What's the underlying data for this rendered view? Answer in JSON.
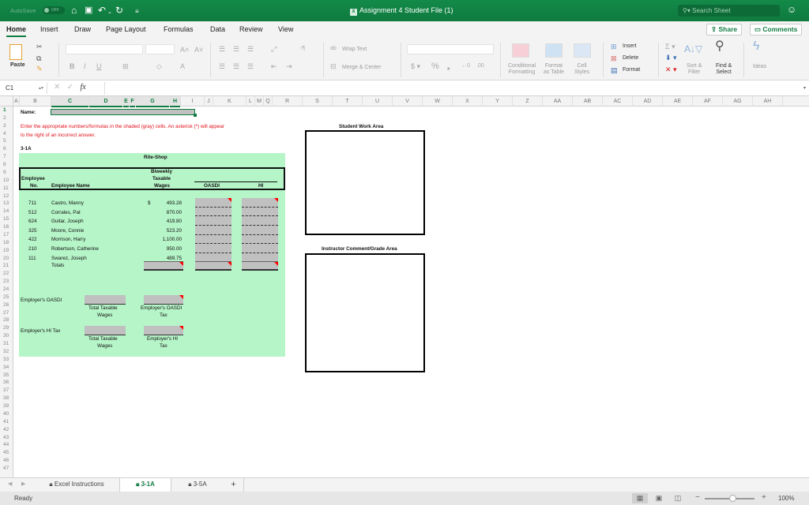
{
  "titlebar": {
    "autosave_label": "AutoSave",
    "autosave_state": "OFF",
    "title": "Assignment 4 Student File (1)",
    "search_placeholder": "Search Sheet"
  },
  "ribbon_tabs": [
    "Home",
    "Insert",
    "Draw",
    "Page Layout",
    "Formulas",
    "Data",
    "Review",
    "View"
  ],
  "active_ribbon_tab": "Home",
  "share_label": "Share",
  "comments_label": "Comments",
  "ribbon": {
    "paste": "Paste",
    "wrap_text": "Wrap Text",
    "merge_center": "Merge & Center",
    "conditional_formatting": [
      "Conditional",
      "Formatting"
    ],
    "format_as_table": [
      "Format",
      "as Table"
    ],
    "cell_styles": [
      "Cell",
      "Styles"
    ],
    "insert": "Insert",
    "delete": "Delete",
    "format": "Format",
    "sort_filter": [
      "Sort &",
      "Filter"
    ],
    "find_select": [
      "Find &",
      "Select"
    ],
    "ideas": "Ideas"
  },
  "formula_bar": {
    "name_box": "C1",
    "fx": "fx",
    "value": ""
  },
  "columns": [
    "A",
    "B",
    "C",
    "D",
    "E",
    "F",
    "G",
    "H",
    "I",
    "J",
    "K",
    "L",
    "M",
    "Q",
    "R",
    "S",
    "T",
    "U",
    "V",
    "W",
    "X",
    "Y",
    "Z",
    "AA",
    "AB",
    "AC",
    "AD",
    "AE",
    "AF",
    "AG",
    "AH"
  ],
  "selected_columns": [
    "C",
    "D",
    "E",
    "F",
    "G",
    "H"
  ],
  "selected_row": 1,
  "row_count": 47,
  "sheet": {
    "name_label": "Name:",
    "instructions_line1": "Enter the appropriate numbers/formulas in the shaded (gray) cells. An asterisk (*) will appear",
    "instructions_line2": "to the right of an incorrect answer.",
    "problem_label": "3-1A",
    "company": "Rite-Shop",
    "headers": {
      "emp_no_1": "Employee",
      "emp_no_2": "No.",
      "emp_name": "Employee Name",
      "wages_1": "Biweekly",
      "wages_2": "Taxable",
      "wages_3": "Wages",
      "oasdi": "OASDI",
      "hi": "HI"
    },
    "currency_symbol": "$",
    "employees": [
      {
        "no": "711",
        "name": "Castro, Manny",
        "wages": "493.28"
      },
      {
        "no": "512",
        "name": "Corrales, Pat",
        "wages": "870.00"
      },
      {
        "no": "624",
        "name": "Guitar, Joseph",
        "wages": "419.80"
      },
      {
        "no": "325",
        "name": "Moore, Connie",
        "wages": "523.20"
      },
      {
        "no": "422",
        "name": "Morrison, Harry",
        "wages": "1,100.00"
      },
      {
        "no": "210",
        "name": "Robertson, Catherine",
        "wages": "950.00"
      },
      {
        "no": "111",
        "name": "Swarez, Joseph",
        "wages": "489.75"
      }
    ],
    "totals_label": "Totals",
    "employer_oasdi_label": "Employer's OASDI",
    "employer_hi_label": "Employer's HI Tax",
    "total_taxable_wages_1": "Total Taxable",
    "total_taxable_wages_2": "Wages",
    "employer_oasdi_tax_1": "Employer's OASDI",
    "employer_oasdi_tax_2": "Tax",
    "employer_hi_tax_1": "Employer's HI",
    "employer_hi_tax_2": "Tax",
    "student_work_area": "Student Work Area",
    "instructor_area": "Instructor Comment/Grade Area"
  },
  "sheet_tabs": [
    {
      "label": "Excel Instructions",
      "locked": true,
      "active": false
    },
    {
      "label": "3-1A",
      "locked": true,
      "active": true
    },
    {
      "label": "3-5A",
      "locked": true,
      "active": false
    }
  ],
  "add_sheet": "+",
  "status": {
    "ready": "Ready",
    "zoom": "100%",
    "zoom_value": 100
  },
  "colors": {
    "brand": "#107c41",
    "sheet_fill": "#b6f5c8",
    "input_cell": "#c0c0c0",
    "error_flag": "#ff0000",
    "instruction_text": "#e0101a"
  }
}
